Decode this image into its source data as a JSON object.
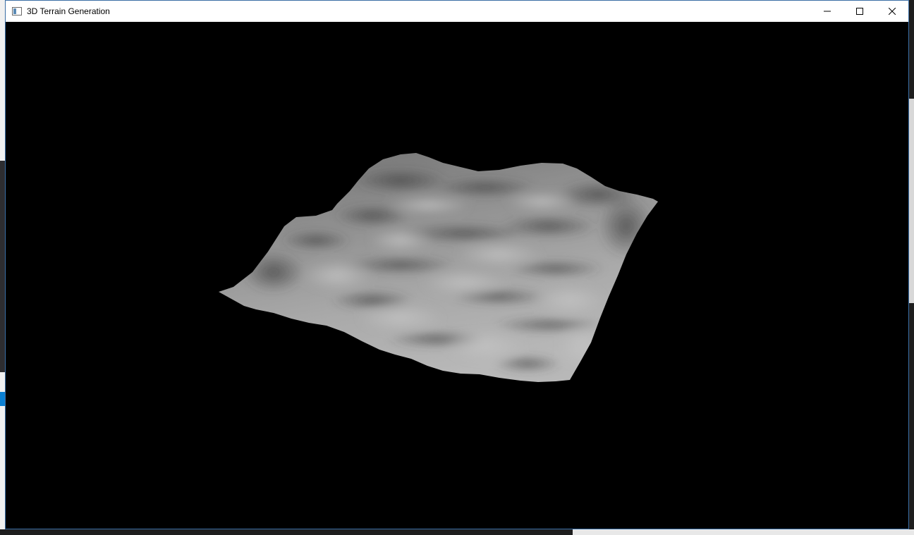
{
  "window": {
    "title": "3D Terrain Generation",
    "controls": {
      "minimize_icon": "minimize-icon",
      "maximize_icon": "maximize-icon",
      "close_icon": "close-icon"
    }
  },
  "viewport": {
    "background": "#000000",
    "content": "terrain-mesh",
    "terrain_color": "#a8a8a8"
  }
}
